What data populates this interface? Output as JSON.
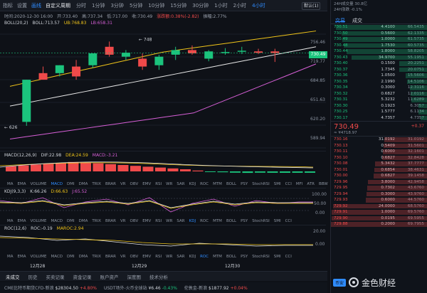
{
  "toolbar": {
    "items": [
      "指标",
      "设置",
      "画线"
    ],
    "period_label": "自定义周期",
    "timeframes": [
      "分时",
      "1分钟",
      "3分钟",
      "5分钟",
      "10分钟",
      "15分钟",
      "30分钟",
      "1小时",
      "2小时",
      "4小时"
    ],
    "active_timeframe": "4小时",
    "dropdown": "默认(1)"
  },
  "infobar": {
    "time": "时间:2020-12-30 16:00",
    "open": "开:733.40",
    "high": "高:737.34",
    "low": "低:717.00",
    "close": "收:730.49",
    "change": "涨跌额:0.38%(-2.82)",
    "amplitude": "振幅:2.77%"
  },
  "boll": {
    "label": "BOLL(20,2)",
    "boll": "BOLL:713.57",
    "ub": "UB:768.83",
    "lb": "LB:658.31"
  },
  "price_axis": [
    "756.46",
    "719.77",
    "684.85",
    "651.63",
    "620.20",
    "589.94"
  ],
  "price_tag": "730.49",
  "high_marker": "748",
  "low_marker": "626",
  "macd": {
    "label": "MACD(12,26,9)",
    "dif": "DIF:22.98",
    "dea": "DEA:24.59",
    "macd": "MACD:-3.21"
  },
  "tabs_row": [
    "MA",
    "EMA",
    "VOLUME",
    "MACD",
    "DMI",
    "DMA",
    "TRIX",
    "BRAR",
    "VR",
    "OBV",
    "EMV",
    "RSI",
    "WR",
    "SAR",
    "KDJ",
    "ROC",
    "MTM",
    "BOLL",
    "PSY",
    "StochRSI",
    "SMI",
    "CCI",
    "MFI",
    "ATR",
    "BBW"
  ],
  "tabs_row2": [
    "MA",
    "EMA",
    "VOLUME",
    "MACD",
    "DMI",
    "DMA",
    "TRIX",
    "BRAR",
    "VR",
    "OBV",
    "EMV",
    "RSI",
    "WR",
    "SAR",
    "KDJ",
    "ROC",
    "MTM",
    "BOLL",
    "PSY",
    "StochRSI",
    "SMI",
    "CCI"
  ],
  "kdj": {
    "label": "KDJ(9,3,3)",
    "k": "K:66.26",
    "d": "D:66.63",
    "j": "J:65.52",
    "axis": [
      "100.00",
      "50.00",
      "0.00"
    ]
  },
  "roc": {
    "label": "ROC(12,6)",
    "roc": "ROC:-0.19",
    "maroc": "MAROC:2.94",
    "axis": [
      "20.00",
      "0.00"
    ]
  },
  "dates": [
    "12月28",
    "12月29",
    "12月30"
  ],
  "bottom_tabs": [
    "未成交",
    "历史",
    "买卖记录",
    "资金记录",
    "账户资产",
    "深度图",
    "技术分析"
  ],
  "ticker": [
    {
      "name": "CME比特币期货CFD-新浪",
      "price": "$28304.50",
      "chg": "+4.80%"
    },
    {
      "name": "USDT场外-火币全球站",
      "price": "¥6.46",
      "chg": "-0.43%"
    },
    {
      "name": "伦敦金-新浪",
      "price": "$1877.92",
      "chg": "+0.04%"
    }
  ],
  "right": {
    "head": [
      "24H成交量 30.8亿",
      "24H涨跌 -0.1%"
    ],
    "tabs": [
      "交易",
      "成交"
    ],
    "asks": [
      {
        "p": "730.51",
        "q": "4.4100",
        "t": "66.5435"
      },
      {
        "p": "730.50",
        "q": "0.5600",
        "t": "62.1335"
      },
      {
        "p": "730.49",
        "q": "1.0000",
        "t": "61.5735"
      },
      {
        "p": "730.48",
        "q": "1.7530",
        "t": "60.5735"
      },
      {
        "p": "730.44",
        "q": "1.8000",
        "t": "58.8205"
      },
      {
        "p": "730.43",
        "q": "34.9700",
        "t": "55.1951"
      },
      {
        "p": "730.40",
        "q": "0.1500",
        "t": "20.2251"
      },
      {
        "p": "730.37",
        "q": "1.7345",
        "t": "20.0751"
      },
      {
        "p": "730.36",
        "q": "1.0500",
        "t": "15.5606"
      },
      {
        "p": "730.35",
        "q": "2.1990",
        "t": "14.5106"
      },
      {
        "p": "730.34",
        "q": "0.3000",
        "t": "12.3116"
      },
      {
        "p": "730.32",
        "q": "0.6827",
        "t": "12.0116"
      },
      {
        "p": "730.31",
        "q": "5.3232",
        "t": "11.6289"
      },
      {
        "p": "730.30",
        "q": "0.1923",
        "t": "6.3057"
      },
      {
        "p": "730.25",
        "q": "1.5777",
        "t": "6.1134"
      },
      {
        "p": "730.17",
        "q": "4.7357",
        "t": "4.7357"
      }
    ],
    "last_price": "730.49",
    "last_sub": "≈ ¥4718.97",
    "last_chg": "+0.37",
    "bids": [
      {
        "p": "730.16",
        "q": "31.0192",
        "t": "31.0192"
      },
      {
        "p": "730.13",
        "q": "0.5409",
        "t": "31.5601"
      },
      {
        "p": "730.11",
        "q": "0.6000",
        "t": "32.1601"
      },
      {
        "p": "730.10",
        "q": "0.6827",
        "t": "32.8428"
      },
      {
        "p": "730.08",
        "q": "5.3432",
        "t": "37.7777"
      },
      {
        "p": "730.01",
        "q": "0.6854",
        "t": "38.4631"
      },
      {
        "p": "730.00",
        "q": "0.6827",
        "t": "39.1458"
      },
      {
        "p": "729.96",
        "q": "3.8000",
        "t": "42.9458"
      },
      {
        "p": "729.95",
        "q": "0.7302",
        "t": "43.6760"
      },
      {
        "p": "729.94",
        "q": "0.3000",
        "t": "43.9760"
      },
      {
        "p": "729.93",
        "q": "0.6000",
        "t": "44.5760"
      },
      {
        "p": "729.92",
        "q": "24.0000",
        "t": "68.5760"
      },
      {
        "p": "729.91",
        "q": "1.0000",
        "t": "69.5760"
      },
      {
        "p": "729.90",
        "q": "0.0195",
        "t": "69.5955"
      },
      {
        "p": "729.88",
        "q": "0.2000",
        "t": "69.7955"
      }
    ],
    "brand": "金色财经",
    "brand_sub": "币安"
  },
  "colors": {
    "up": "#1bc47d",
    "down": "#f04a4a",
    "accent": "#2f8cff",
    "boll_mid": "#e8e8e8",
    "boll_ub": "#f0c419",
    "boll_lb": "#d65fd6"
  },
  "chart_data": {
    "type": "candlestick",
    "title": "",
    "candles": [
      {
        "o": 626,
        "h": 640,
        "l": 620,
        "c": 690
      },
      {
        "o": 700,
        "h": 710,
        "l": 690,
        "c": 690
      },
      {
        "o": 700,
        "h": 712,
        "l": 695,
        "c": 712
      },
      {
        "o": 710,
        "h": 720,
        "l": 690,
        "c": 695
      },
      {
        "o": 712,
        "h": 730,
        "l": 708,
        "c": 730
      },
      {
        "o": 740,
        "h": 748,
        "l": 725,
        "c": 728
      },
      {
        "o": 725,
        "h": 735,
        "l": 720,
        "c": 731
      },
      {
        "o": 722,
        "h": 730,
        "l": 705,
        "c": 710
      },
      {
        "o": 712,
        "h": 728,
        "l": 705,
        "c": 725
      },
      {
        "o": 728,
        "h": 740,
        "l": 720,
        "c": 735
      },
      {
        "o": 735,
        "h": 742,
        "l": 728,
        "c": 730
      },
      {
        "o": 722,
        "h": 735,
        "l": 718,
        "c": 733
      },
      {
        "o": 732,
        "h": 738,
        "l": 728,
        "c": 732
      },
      {
        "o": 733,
        "h": 740,
        "l": 729,
        "c": 734
      },
      {
        "o": 733,
        "h": 737,
        "l": 729,
        "c": 731
      },
      {
        "o": 733,
        "h": 737,
        "l": 717,
        "c": 730.49
      }
    ],
    "ylim": [
      580,
      770
    ]
  }
}
